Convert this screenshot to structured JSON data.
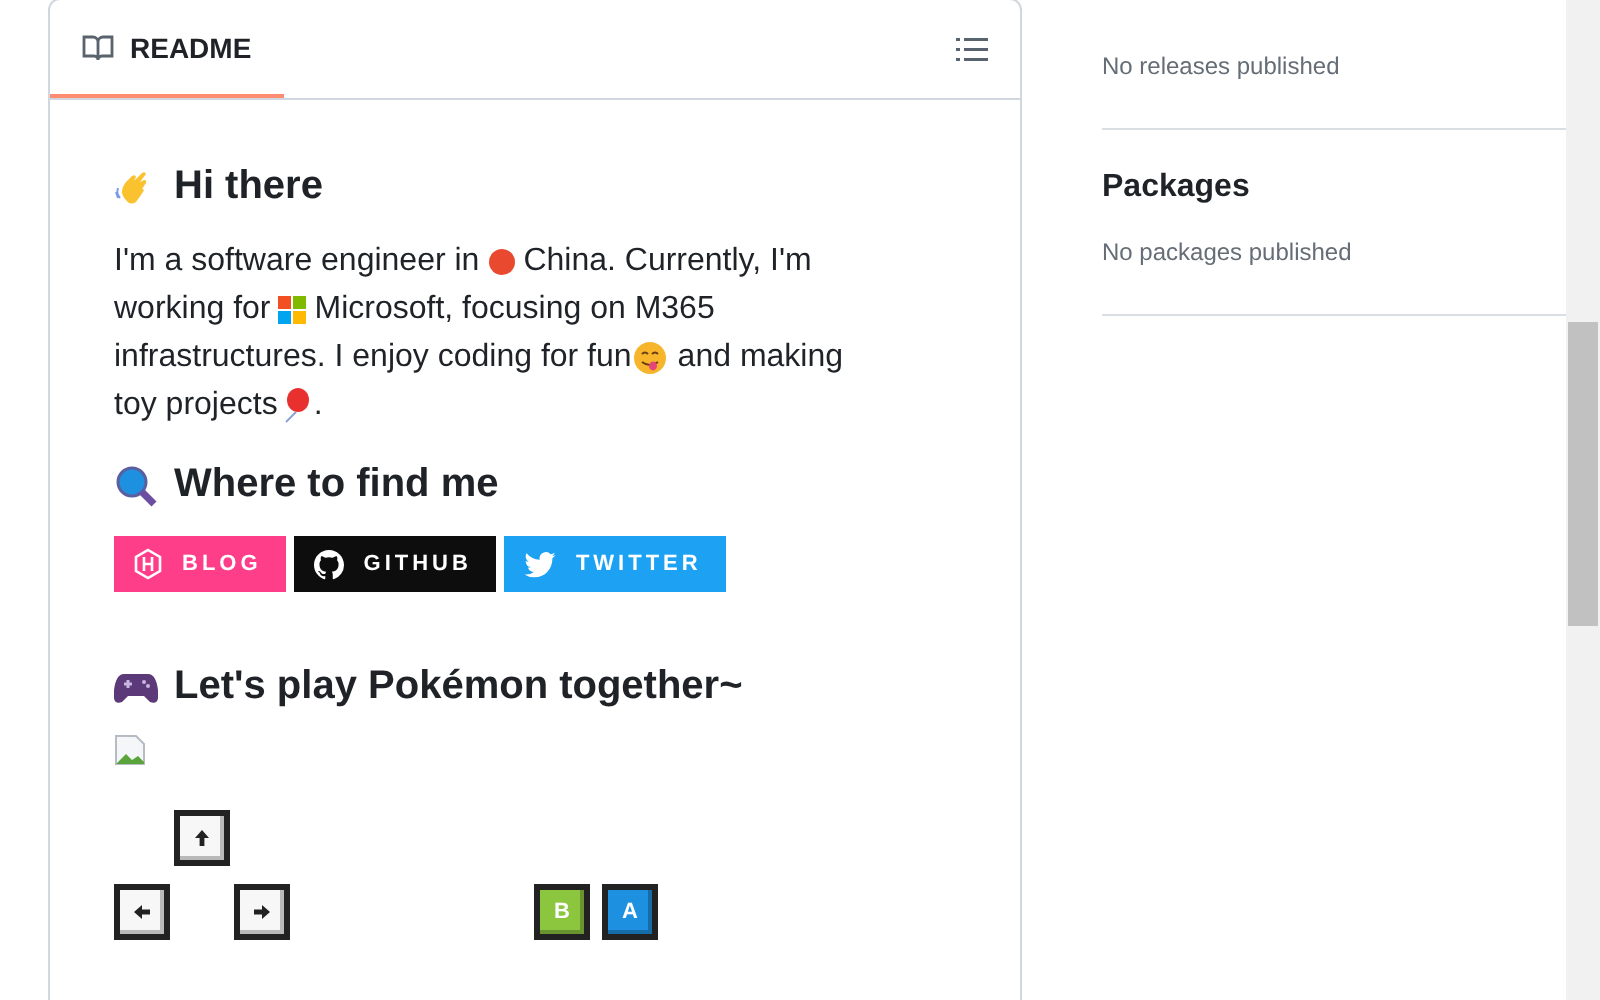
{
  "readme": {
    "tab": {
      "label": "README",
      "selected": true
    },
    "intro": {
      "title": "Hi there",
      "lines": [
        [
          {
            "kind": "text",
            "text": "I'm a software engineer in"
          },
          {
            "kind": "icon"
          },
          {
            "kind": "text",
            "text": "China. Currently, I'm"
          }
        ],
        [
          {
            "kind": "text",
            "text": "working for"
          },
          {
            "kind": "icon"
          },
          {
            "kind": "text",
            "text": "Microsoft, focusing on M365"
          }
        ],
        [
          {
            "kind": "text",
            "text": "infrastructures. I enjoy coding for fun"
          },
          {
            "kind": "icon"
          },
          {
            "kind": "text",
            "text": "and making"
          }
        ],
        [
          {
            "kind": "text",
            "text": "toy projects"
          },
          {
            "kind": "icon"
          },
          {
            "kind": "text",
            "text": "."
          }
        ]
      ]
    },
    "find": {
      "title": "Where to find me",
      "badges": [
        {
          "label": "BLOG",
          "color": "#ff3e89"
        },
        {
          "label": "GITHUB",
          "color": "#0d0d0d"
        },
        {
          "label": "TWITTER",
          "color": "#1da1f2"
        }
      ]
    },
    "play": {
      "title": "Let's play Pokémon together~",
      "keys": [
        {
          "kind": "up"
        },
        {
          "kind": "left"
        },
        {
          "kind": "right"
        },
        {
          "kind": "letter",
          "label": "B",
          "color": "#8cc63f"
        },
        {
          "kind": "letter",
          "label": "A",
          "color": "#1e90e0"
        }
      ]
    }
  },
  "sidebar": {
    "sections": [
      {
        "note": "No releases published"
      },
      {
        "title": "Packages",
        "note": "No packages published"
      }
    ]
  }
}
